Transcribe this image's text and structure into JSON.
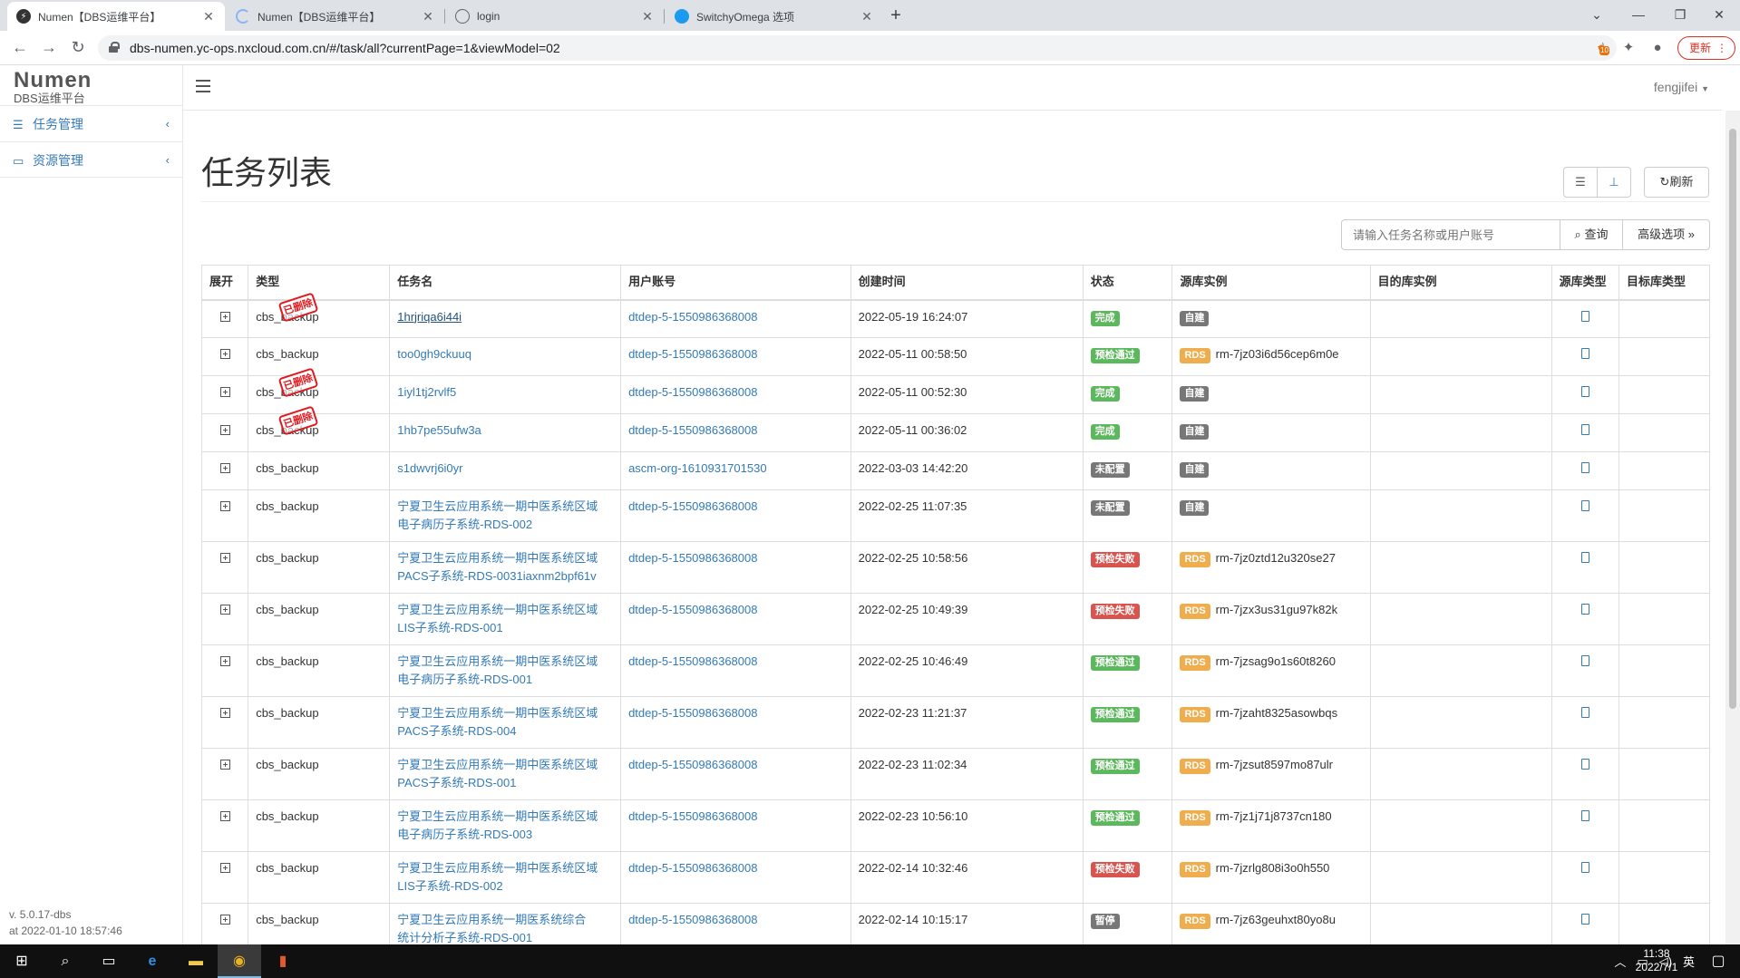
{
  "browser": {
    "tabs": [
      {
        "title": "Numen【DBS运维平台】",
        "active": true
      },
      {
        "title": "Numen【DBS运维平台】",
        "active": false
      },
      {
        "title": "login",
        "active": false
      },
      {
        "title": "SwitchyOmega 选项",
        "active": false
      }
    ],
    "url": "dbs-numen.yc-ops.nxcloud.com.cn/#/task/all?currentPage=1&viewModel=02",
    "update_label": "更新",
    "ext_badge": "10"
  },
  "app": {
    "brand": "Numen",
    "subtitle": "DBS运维平台",
    "menu": [
      {
        "label": "任务管理",
        "icon": "list-icon"
      },
      {
        "label": "资源管理",
        "icon": "monitor-icon"
      }
    ],
    "version": "v. 5.0.17-dbs",
    "build_time": "at 2022-01-10 18:57:46",
    "user": "fengjifei"
  },
  "page": {
    "title": "任务列表",
    "refresh_label": "刷新",
    "search_placeholder": "请输入任务名称或用户账号",
    "query_label": "查询",
    "advanced_label": "高级选项"
  },
  "table": {
    "columns": [
      "展开",
      "类型",
      "任务名",
      "用户账号",
      "创建时间",
      "状态",
      "源库实例",
      "目的库实例",
      "源库类型",
      "目标库类型"
    ],
    "deleted_label": "已删除",
    "rows": [
      {
        "type": "cbs_backup",
        "deleted": true,
        "name": "1hrjriqa6i44i",
        "name2": "",
        "underline": true,
        "user": "dtdep-5-1550986368008",
        "created": "2022-05-19 16:24:07",
        "status": "完成",
        "status_kind": "success",
        "src_label": "自建",
        "src_instance": ""
      },
      {
        "type": "cbs_backup",
        "deleted": false,
        "name": "too0gh9ckuuq",
        "name2": "",
        "underline": false,
        "user": "dtdep-5-1550986368008",
        "created": "2022-05-11 00:58:50",
        "status": "预检通过",
        "status_kind": "success",
        "src_label": "RDS",
        "src_instance": "rm-7jz03i6d56cep6m0e"
      },
      {
        "type": "cbs_backup",
        "deleted": true,
        "name": "1iyl1tj2rvlf5",
        "name2": "",
        "underline": false,
        "user": "dtdep-5-1550986368008",
        "created": "2022-05-11 00:52:30",
        "status": "完成",
        "status_kind": "success",
        "src_label": "自建",
        "src_instance": ""
      },
      {
        "type": "cbs_backup",
        "deleted": true,
        "name": "1hb7pe55ufw3a",
        "name2": "",
        "underline": false,
        "user": "dtdep-5-1550986368008",
        "created": "2022-05-11 00:36:02",
        "status": "完成",
        "status_kind": "success",
        "src_label": "自建",
        "src_instance": ""
      },
      {
        "type": "cbs_backup",
        "deleted": false,
        "name": "s1dwvrj6i0yr",
        "name2": "",
        "underline": false,
        "user": "ascm-org-1610931701530",
        "created": "2022-03-03 14:42:20",
        "status": "未配置",
        "status_kind": "default",
        "src_label": "自建",
        "src_instance": ""
      },
      {
        "type": "cbs_backup",
        "deleted": false,
        "name": "宁夏卫生云应用系统一期中医系统区域",
        "name2": "电子病历子系统-RDS-002",
        "underline": false,
        "user": "dtdep-5-1550986368008",
        "created": "2022-02-25 11:07:35",
        "status": "未配置",
        "status_kind": "default",
        "src_label": "自建",
        "src_instance": ""
      },
      {
        "type": "cbs_backup",
        "deleted": false,
        "name": "宁夏卫生云应用系统一期中医系统区域",
        "name2": "PACS子系统-RDS-0031iaxnm2bpf61v",
        "underline": false,
        "user": "dtdep-5-1550986368008",
        "created": "2022-02-25 10:58:56",
        "status": "预检失败",
        "status_kind": "danger",
        "src_label": "RDS",
        "src_instance": "rm-7jz0ztd12u320se27"
      },
      {
        "type": "cbs_backup",
        "deleted": false,
        "name": "宁夏卫生云应用系统一期中医系统区域",
        "name2": "LIS子系统-RDS-001",
        "underline": false,
        "user": "dtdep-5-1550986368008",
        "created": "2022-02-25 10:49:39",
        "status": "预检失败",
        "status_kind": "danger",
        "src_label": "RDS",
        "src_instance": "rm-7jzx3us31gu97k82k"
      },
      {
        "type": "cbs_backup",
        "deleted": false,
        "name": "宁夏卫生云应用系统一期中医系统区域",
        "name2": "电子病历子系统-RDS-001",
        "underline": false,
        "user": "dtdep-5-1550986368008",
        "created": "2022-02-25 10:46:49",
        "status": "预检通过",
        "status_kind": "success",
        "src_label": "RDS",
        "src_instance": "rm-7jzsag9o1s60t8260"
      },
      {
        "type": "cbs_backup",
        "deleted": false,
        "name": "宁夏卫生云应用系统一期中医系统区域",
        "name2": "PACS子系统-RDS-004",
        "underline": false,
        "user": "dtdep-5-1550986368008",
        "created": "2022-02-23 11:21:37",
        "status": "预检通过",
        "status_kind": "success",
        "src_label": "RDS",
        "src_instance": "rm-7jzaht8325asowbqs"
      },
      {
        "type": "cbs_backup",
        "deleted": false,
        "name": "宁夏卫生云应用系统一期中医系统区域",
        "name2": "PACS子系统-RDS-001",
        "underline": false,
        "user": "dtdep-5-1550986368008",
        "created": "2022-02-23 11:02:34",
        "status": "预检通过",
        "status_kind": "success",
        "src_label": "RDS",
        "src_instance": "rm-7jzsut8597mo87ulr"
      },
      {
        "type": "cbs_backup",
        "deleted": false,
        "name": "宁夏卫生云应用系统一期中医系统区域",
        "name2": "电子病历子系统-RDS-003",
        "underline": false,
        "user": "dtdep-5-1550986368008",
        "created": "2022-02-23 10:56:10",
        "status": "预检通过",
        "status_kind": "success",
        "src_label": "RDS",
        "src_instance": "rm-7jz1j71j8737cn180"
      },
      {
        "type": "cbs_backup",
        "deleted": false,
        "name": "宁夏卫生云应用系统一期中医系统区域",
        "name2": "LIS子系统-RDS-002",
        "underline": false,
        "user": "dtdep-5-1550986368008",
        "created": "2022-02-14 10:32:46",
        "status": "预检失败",
        "status_kind": "danger",
        "src_label": "RDS",
        "src_instance": "rm-7jzrlg808i3o0h550"
      },
      {
        "type": "cbs_backup",
        "deleted": false,
        "name": "宁夏卫生云应用系统一期医系统综合",
        "name2": "统计分析子系统-RDS-001",
        "underline": false,
        "user": "dtdep-5-1550986368008",
        "created": "2022-02-14 10:15:17",
        "status": "暂停",
        "status_kind": "default",
        "src_label": "RDS",
        "src_instance": "rm-7jz63geuhxt80yo8u"
      }
    ]
  },
  "taskbar": {
    "ime": "英",
    "time": "11:38",
    "date": "2022/7/1"
  }
}
